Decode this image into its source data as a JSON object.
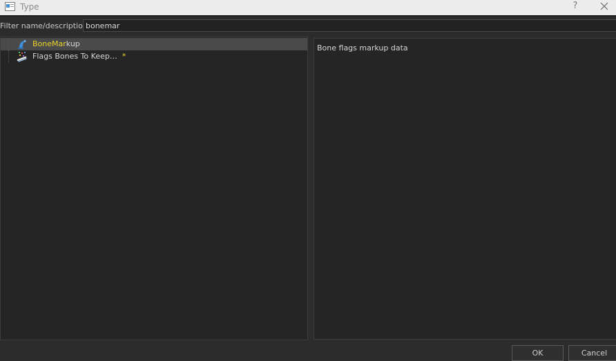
{
  "window": {
    "title": "Type",
    "help_label": "?"
  },
  "filter": {
    "label": "Filter name/description:",
    "value": "bonemar"
  },
  "tree": {
    "items": [
      {
        "match": "BoneMar",
        "rest": "kup",
        "icon": "bone-markup-icon"
      },
      {
        "label": "Flags Bones To Keep…",
        "modified_marker": "*",
        "icon": "flags-bones-icon"
      }
    ]
  },
  "description": {
    "text": "Bone flags markup data"
  },
  "buttons": {
    "ok": "OK",
    "cancel": "Cancel"
  },
  "colors": {
    "highlight": "#e8d22a",
    "selection": "#4a4a4a",
    "background": "#252525"
  }
}
